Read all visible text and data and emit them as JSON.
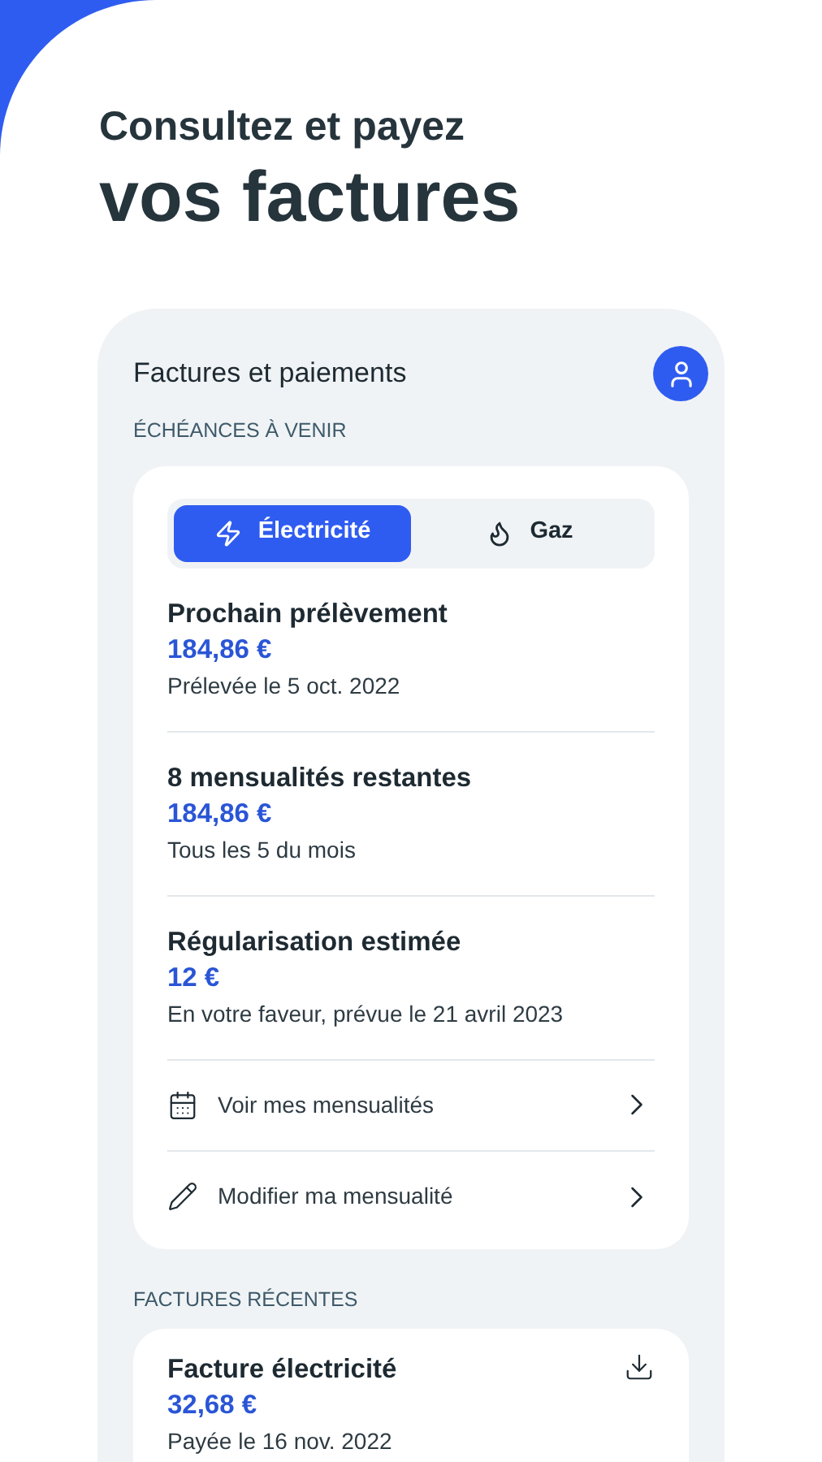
{
  "headline": {
    "line_1": "Consultez et payez",
    "line_2": "vos factures"
  },
  "screen": {
    "title": "Factures et paiements",
    "section_upcoming": "ÉCHÉANCES À VENIR",
    "tabs": [
      {
        "label": "Électricité",
        "selected": true
      },
      {
        "label": "Gaz",
        "selected": false
      }
    ],
    "items": [
      {
        "title": "Prochain prélèvement",
        "amount": "184,86 €",
        "detail": "Prélevée le 5 oct. 2022"
      },
      {
        "title": "8 mensualités restantes",
        "amount": "184,86 €",
        "detail": "Tous les 5 du mois"
      },
      {
        "title": "Régularisation estimée",
        "amount": "12 €",
        "detail": "En votre faveur, prévue le 21 avril 2023"
      }
    ],
    "links": [
      {
        "label": "Voir mes mensualités"
      },
      {
        "label": "Modifier ma mensualité"
      }
    ],
    "section_recent": "FACTURES RÉCENTES",
    "recent": [
      {
        "title": "Facture électricité",
        "amount": "32,68 €",
        "detail": "Payée le 16 nov. 2022"
      }
    ]
  }
}
